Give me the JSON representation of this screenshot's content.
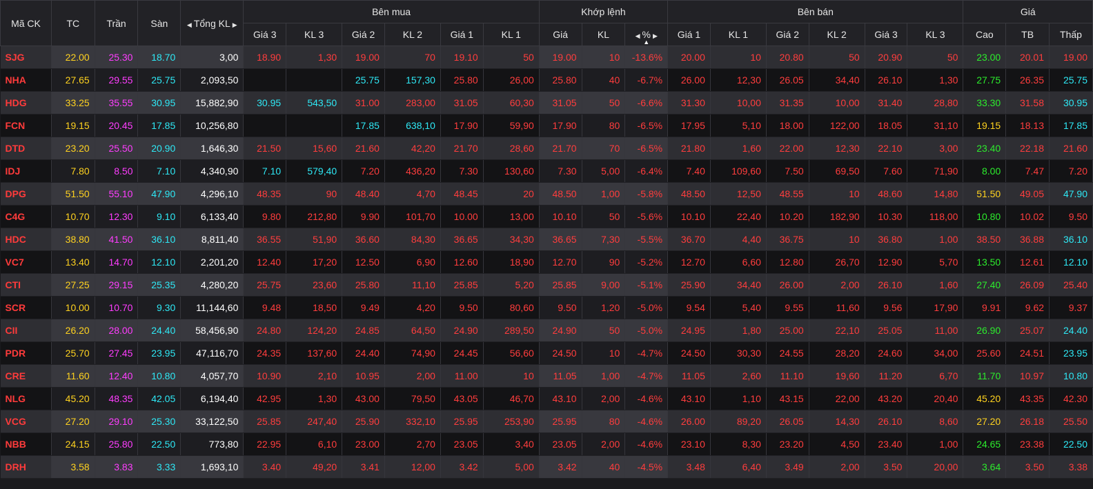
{
  "headers": {
    "symbol": "Mã CK",
    "ref": "TC",
    "ceiling": "Trần",
    "floor": "Sàn",
    "total_vol": "Tổng KL",
    "buy_group": "Bên mua",
    "match_group": "Khớp lệnh",
    "sell_group": "Bên bán",
    "price_group": "Giá",
    "sub": {
      "bid_p3": "Giá 3",
      "bid_v3": "KL 3",
      "bid_p2": "Giá 2",
      "bid_v2": "KL 2",
      "bid_p1": "Giá 1",
      "bid_v1": "KL 1",
      "match_price": "Giá",
      "match_vol": "KL",
      "match_pct": "%",
      "ask_p1": "Giá 1",
      "ask_v1": "KL 1",
      "ask_p2": "Giá 2",
      "ask_v2": "KL 2",
      "ask_p3": "Giá 3",
      "ask_v3": "KL 3",
      "high": "Cao",
      "avg": "TB",
      "low": "Thấp"
    }
  },
  "colors": {
    "down": "#ff3d3d",
    "ref": "#ffd21f",
    "ceiling": "#ff3dff",
    "floor": "#2ee8f5",
    "up": "#2cec2c",
    "neutral": "#ffffff"
  },
  "rows": [
    {
      "sym": "SJG",
      "tc": "22.00",
      "tran": "25.30",
      "san": "18.70",
      "tkl": "3,00",
      "b3p": "18.90",
      "b3v": "1,30",
      "b2p": "19.00",
      "b2v": "70",
      "b1p": "19.10",
      "b1v": "50",
      "mp": "19.00",
      "mv": "10",
      "pct": "-13.6%",
      "a1p": "20.00",
      "a1v": "10",
      "a2p": "20.80",
      "a2v": "50",
      "a3p": "20.90",
      "a3v": "50",
      "hi": "23.00",
      "avg": "20.01",
      "lo": "19.00",
      "cl": {
        "b3": "red",
        "b2": "red",
        "b1": "red",
        "a1": "red",
        "a2": "red",
        "a3": "red",
        "hi": "grn",
        "avg": "red",
        "lo": "red"
      }
    },
    {
      "sym": "NHA",
      "tc": "27.65",
      "tran": "29.55",
      "san": "25.75",
      "tkl": "2,093,50",
      "b3p": "",
      "b3v": "",
      "b2p": "25.75",
      "b2v": "157,30",
      "b1p": "25.80",
      "b1v": "26,00",
      "mp": "25.80",
      "mv": "40",
      "pct": "-6.7%",
      "a1p": "26.00",
      "a1v": "12,30",
      "a2p": "26.05",
      "a2v": "34,40",
      "a3p": "26.10",
      "a3v": "1,30",
      "hi": "27.75",
      "avg": "26.35",
      "lo": "25.75",
      "cl": {
        "b3": "red",
        "b2": "cyn",
        "b1": "red",
        "a1": "red",
        "a2": "red",
        "a3": "red",
        "hi": "grn",
        "avg": "red",
        "lo": "cyn"
      }
    },
    {
      "sym": "HDG",
      "tc": "33.25",
      "tran": "35.55",
      "san": "30.95",
      "tkl": "15,882,90",
      "b3p": "30.95",
      "b3v": "543,50",
      "b2p": "31.00",
      "b2v": "283,00",
      "b1p": "31.05",
      "b1v": "60,30",
      "mp": "31.05",
      "mv": "50",
      "pct": "-6.6%",
      "a1p": "31.30",
      "a1v": "10,00",
      "a2p": "31.35",
      "a2v": "10,00",
      "a3p": "31.40",
      "a3v": "28,80",
      "hi": "33.30",
      "avg": "31.58",
      "lo": "30.95",
      "cl": {
        "b3": "cyn",
        "b2": "red",
        "b1": "red",
        "a1": "red",
        "a2": "red",
        "a3": "red",
        "hi": "grn",
        "avg": "red",
        "lo": "cyn"
      }
    },
    {
      "sym": "FCN",
      "tc": "19.15",
      "tran": "20.45",
      "san": "17.85",
      "tkl": "10,256,80",
      "b3p": "",
      "b3v": "",
      "b2p": "17.85",
      "b2v": "638,10",
      "b1p": "17.90",
      "b1v": "59,90",
      "mp": "17.90",
      "mv": "80",
      "pct": "-6.5%",
      "a1p": "17.95",
      "a1v": "5,10",
      "a2p": "18.00",
      "a2v": "122,00",
      "a3p": "18.05",
      "a3v": "31,10",
      "hi": "19.15",
      "avg": "18.13",
      "lo": "17.85",
      "cl": {
        "b3": "red",
        "b2": "cyn",
        "b1": "red",
        "a1": "red",
        "a2": "red",
        "a3": "red",
        "hi": "yel",
        "avg": "red",
        "lo": "cyn"
      }
    },
    {
      "sym": "DTD",
      "tc": "23.20",
      "tran": "25.50",
      "san": "20.90",
      "tkl": "1,646,30",
      "b3p": "21.50",
      "b3v": "15,60",
      "b2p": "21.60",
      "b2v": "42,20",
      "b1p": "21.70",
      "b1v": "28,60",
      "mp": "21.70",
      "mv": "70",
      "pct": "-6.5%",
      "a1p": "21.80",
      "a1v": "1,60",
      "a2p": "22.00",
      "a2v": "12,30",
      "a3p": "22.10",
      "a3v": "3,00",
      "hi": "23.40",
      "avg": "22.18",
      "lo": "21.60",
      "cl": {
        "b3": "red",
        "b2": "red",
        "b1": "red",
        "a1": "red",
        "a2": "red",
        "a3": "red",
        "hi": "grn",
        "avg": "red",
        "lo": "red"
      }
    },
    {
      "sym": "IDJ",
      "tc": "7.80",
      "tran": "8.50",
      "san": "7.10",
      "tkl": "4,340,90",
      "b3p": "7.10",
      "b3v": "579,40",
      "b2p": "7.20",
      "b2v": "436,20",
      "b1p": "7.30",
      "b1v": "130,60",
      "mp": "7.30",
      "mv": "5,00",
      "pct": "-6.4%",
      "a1p": "7.40",
      "a1v": "109,60",
      "a2p": "7.50",
      "a2v": "69,50",
      "a3p": "7.60",
      "a3v": "71,90",
      "hi": "8.00",
      "avg": "7.47",
      "lo": "7.20",
      "cl": {
        "b3": "cyn",
        "b2": "red",
        "b1": "red",
        "a1": "red",
        "a2": "red",
        "a3": "red",
        "hi": "grn",
        "avg": "red",
        "lo": "red"
      }
    },
    {
      "sym": "DPG",
      "tc": "51.50",
      "tran": "55.10",
      "san": "47.90",
      "tkl": "4,296,10",
      "b3p": "48.35",
      "b3v": "90",
      "b2p": "48.40",
      "b2v": "4,70",
      "b1p": "48.45",
      "b1v": "20",
      "mp": "48.50",
      "mv": "1,00",
      "pct": "-5.8%",
      "a1p": "48.50",
      "a1v": "12,50",
      "a2p": "48.55",
      "a2v": "10",
      "a3p": "48.60",
      "a3v": "14,80",
      "hi": "51.50",
      "avg": "49.05",
      "lo": "47.90",
      "cl": {
        "b3": "red",
        "b2": "red",
        "b1": "red",
        "a1": "red",
        "a2": "red",
        "a3": "red",
        "hi": "yel",
        "avg": "red",
        "lo": "cyn"
      }
    },
    {
      "sym": "C4G",
      "tc": "10.70",
      "tran": "12.30",
      "san": "9.10",
      "tkl": "6,133,40",
      "b3p": "9.80",
      "b3v": "212,80",
      "b2p": "9.90",
      "b2v": "101,70",
      "b1p": "10.00",
      "b1v": "13,00",
      "mp": "10.10",
      "mv": "50",
      "pct": "-5.6%",
      "a1p": "10.10",
      "a1v": "22,40",
      "a2p": "10.20",
      "a2v": "182,90",
      "a3p": "10.30",
      "a3v": "118,00",
      "hi": "10.80",
      "avg": "10.02",
      "lo": "9.50",
      "cl": {
        "b3": "red",
        "b2": "red",
        "b1": "red",
        "a1": "red",
        "a2": "red",
        "a3": "red",
        "hi": "grn",
        "avg": "red",
        "lo": "red"
      }
    },
    {
      "sym": "HDC",
      "tc": "38.80",
      "tran": "41.50",
      "san": "36.10",
      "tkl": "8,811,40",
      "b3p": "36.55",
      "b3v": "51,90",
      "b2p": "36.60",
      "b2v": "84,30",
      "b1p": "36.65",
      "b1v": "34,30",
      "mp": "36.65",
      "mv": "7,30",
      "pct": "-5.5%",
      "a1p": "36.70",
      "a1v": "4,40",
      "a2p": "36.75",
      "a2v": "10",
      "a3p": "36.80",
      "a3v": "1,00",
      "hi": "38.50",
      "avg": "36.88",
      "lo": "36.10",
      "cl": {
        "b3": "red",
        "b2": "red",
        "b1": "red",
        "a1": "red",
        "a2": "red",
        "a3": "red",
        "hi": "red",
        "avg": "red",
        "lo": "cyn"
      }
    },
    {
      "sym": "VC7",
      "tc": "13.40",
      "tran": "14.70",
      "san": "12.10",
      "tkl": "2,201,20",
      "b3p": "12.40",
      "b3v": "17,20",
      "b2p": "12.50",
      "b2v": "6,90",
      "b1p": "12.60",
      "b1v": "18,90",
      "mp": "12.70",
      "mv": "90",
      "pct": "-5.2%",
      "a1p": "12.70",
      "a1v": "6,60",
      "a2p": "12.80",
      "a2v": "26,70",
      "a3p": "12.90",
      "a3v": "5,70",
      "hi": "13.50",
      "avg": "12.61",
      "lo": "12.10",
      "cl": {
        "b3": "red",
        "b2": "red",
        "b1": "red",
        "a1": "red",
        "a2": "red",
        "a3": "red",
        "hi": "grn",
        "avg": "red",
        "lo": "cyn"
      }
    },
    {
      "sym": "CTI",
      "tc": "27.25",
      "tran": "29.15",
      "san": "25.35",
      "tkl": "4,280,20",
      "b3p": "25.75",
      "b3v": "23,60",
      "b2p": "25.80",
      "b2v": "11,10",
      "b1p": "25.85",
      "b1v": "5,20",
      "mp": "25.85",
      "mv": "9,00",
      "pct": "-5.1%",
      "a1p": "25.90",
      "a1v": "34,40",
      "a2p": "26.00",
      "a2v": "2,00",
      "a3p": "26.10",
      "a3v": "1,60",
      "hi": "27.40",
      "avg": "26.09",
      "lo": "25.40",
      "cl": {
        "b3": "red",
        "b2": "red",
        "b1": "red",
        "a1": "red",
        "a2": "red",
        "a3": "red",
        "hi": "grn",
        "avg": "red",
        "lo": "red"
      }
    },
    {
      "sym": "SCR",
      "tc": "10.00",
      "tran": "10.70",
      "san": "9.30",
      "tkl": "11,144,60",
      "b3p": "9.48",
      "b3v": "18,50",
      "b2p": "9.49",
      "b2v": "4,20",
      "b1p": "9.50",
      "b1v": "80,60",
      "mp": "9.50",
      "mv": "1,20",
      "pct": "-5.0%",
      "a1p": "9.54",
      "a1v": "5,40",
      "a2p": "9.55",
      "a2v": "11,60",
      "a3p": "9.56",
      "a3v": "17,90",
      "hi": "9.91",
      "avg": "9.62",
      "lo": "9.37",
      "cl": {
        "b3": "red",
        "b2": "red",
        "b1": "red",
        "a1": "red",
        "a2": "red",
        "a3": "red",
        "hi": "red",
        "avg": "red",
        "lo": "red"
      }
    },
    {
      "sym": "CII",
      "tc": "26.20",
      "tran": "28.00",
      "san": "24.40",
      "tkl": "58,456,90",
      "b3p": "24.80",
      "b3v": "124,20",
      "b2p": "24.85",
      "b2v": "64,50",
      "b1p": "24.90",
      "b1v": "289,50",
      "mp": "24.90",
      "mv": "50",
      "pct": "-5.0%",
      "a1p": "24.95",
      "a1v": "1,80",
      "a2p": "25.00",
      "a2v": "22,10",
      "a3p": "25.05",
      "a3v": "11,00",
      "hi": "26.90",
      "avg": "25.07",
      "lo": "24.40",
      "cl": {
        "b3": "red",
        "b2": "red",
        "b1": "red",
        "a1": "red",
        "a2": "red",
        "a3": "red",
        "hi": "grn",
        "avg": "red",
        "lo": "cyn"
      }
    },
    {
      "sym": "PDR",
      "tc": "25.70",
      "tran": "27.45",
      "san": "23.95",
      "tkl": "47,116,70",
      "b3p": "24.35",
      "b3v": "137,60",
      "b2p": "24.40",
      "b2v": "74,90",
      "b1p": "24.45",
      "b1v": "56,60",
      "mp": "24.50",
      "mv": "10",
      "pct": "-4.7%",
      "a1p": "24.50",
      "a1v": "30,30",
      "a2p": "24.55",
      "a2v": "28,20",
      "a3p": "24.60",
      "a3v": "34,00",
      "hi": "25.60",
      "avg": "24.51",
      "lo": "23.95",
      "cl": {
        "b3": "red",
        "b2": "red",
        "b1": "red",
        "a1": "red",
        "a2": "red",
        "a3": "red",
        "hi": "red",
        "avg": "red",
        "lo": "cyn"
      }
    },
    {
      "sym": "CRE",
      "tc": "11.60",
      "tran": "12.40",
      "san": "10.80",
      "tkl": "4,057,70",
      "b3p": "10.90",
      "b3v": "2,10",
      "b2p": "10.95",
      "b2v": "2,00",
      "b1p": "11.00",
      "b1v": "10",
      "mp": "11.05",
      "mv": "1,00",
      "pct": "-4.7%",
      "a1p": "11.05",
      "a1v": "2,60",
      "a2p": "11.10",
      "a2v": "19,60",
      "a3p": "11.20",
      "a3v": "6,70",
      "hi": "11.70",
      "avg": "10.97",
      "lo": "10.80",
      "cl": {
        "b3": "red",
        "b2": "red",
        "b1": "red",
        "a1": "red",
        "a2": "red",
        "a3": "red",
        "hi": "grn",
        "avg": "red",
        "lo": "cyn"
      }
    },
    {
      "sym": "NLG",
      "tc": "45.20",
      "tran": "48.35",
      "san": "42.05",
      "tkl": "6,194,40",
      "b3p": "42.95",
      "b3v": "1,30",
      "b2p": "43.00",
      "b2v": "79,50",
      "b1p": "43.05",
      "b1v": "46,70",
      "mp": "43.10",
      "mv": "2,00",
      "pct": "-4.6%",
      "a1p": "43.10",
      "a1v": "1,10",
      "a2p": "43.15",
      "a2v": "22,00",
      "a3p": "43.20",
      "a3v": "20,40",
      "hi": "45.20",
      "avg": "43.35",
      "lo": "42.30",
      "cl": {
        "b3": "red",
        "b2": "red",
        "b1": "red",
        "a1": "red",
        "a2": "red",
        "a3": "red",
        "hi": "yel",
        "avg": "red",
        "lo": "red"
      }
    },
    {
      "sym": "VCG",
      "tc": "27.20",
      "tran": "29.10",
      "san": "25.30",
      "tkl": "33,122,50",
      "b3p": "25.85",
      "b3v": "247,40",
      "b2p": "25.90",
      "b2v": "332,10",
      "b1p": "25.95",
      "b1v": "253,90",
      "mp": "25.95",
      "mv": "80",
      "pct": "-4.6%",
      "a1p": "26.00",
      "a1v": "89,20",
      "a2p": "26.05",
      "a2v": "14,30",
      "a3p": "26.10",
      "a3v": "8,60",
      "hi": "27.20",
      "avg": "26.18",
      "lo": "25.50",
      "cl": {
        "b3": "red",
        "b2": "red",
        "b1": "red",
        "a1": "red",
        "a2": "red",
        "a3": "red",
        "hi": "yel",
        "avg": "red",
        "lo": "red"
      }
    },
    {
      "sym": "NBB",
      "tc": "24.15",
      "tran": "25.80",
      "san": "22.50",
      "tkl": "773,80",
      "b3p": "22.95",
      "b3v": "6,10",
      "b2p": "23.00",
      "b2v": "2,70",
      "b1p": "23.05",
      "b1v": "3,40",
      "mp": "23.05",
      "mv": "2,00",
      "pct": "-4.6%",
      "a1p": "23.10",
      "a1v": "8,30",
      "a2p": "23.20",
      "a2v": "4,50",
      "a3p": "23.40",
      "a3v": "1,00",
      "hi": "24.65",
      "avg": "23.38",
      "lo": "22.50",
      "cl": {
        "b3": "red",
        "b2": "red",
        "b1": "red",
        "a1": "red",
        "a2": "red",
        "a3": "red",
        "hi": "grn",
        "avg": "red",
        "lo": "cyn"
      }
    },
    {
      "sym": "DRH",
      "tc": "3.58",
      "tran": "3.83",
      "san": "3.33",
      "tkl": "1,693,10",
      "b3p": "3.40",
      "b3v": "49,20",
      "b2p": "3.41",
      "b2v": "12,00",
      "b1p": "3.42",
      "b1v": "5,00",
      "mp": "3.42",
      "mv": "40",
      "pct": "-4.5%",
      "a1p": "3.48",
      "a1v": "6,40",
      "a2p": "3.49",
      "a2v": "2,00",
      "a3p": "3.50",
      "a3v": "20,00",
      "hi": "3.64",
      "avg": "3.50",
      "lo": "3.38",
      "cl": {
        "b3": "red",
        "b2": "red",
        "b1": "red",
        "a1": "red",
        "a2": "red",
        "a3": "red",
        "hi": "grn",
        "avg": "red",
        "lo": "red"
      }
    }
  ]
}
